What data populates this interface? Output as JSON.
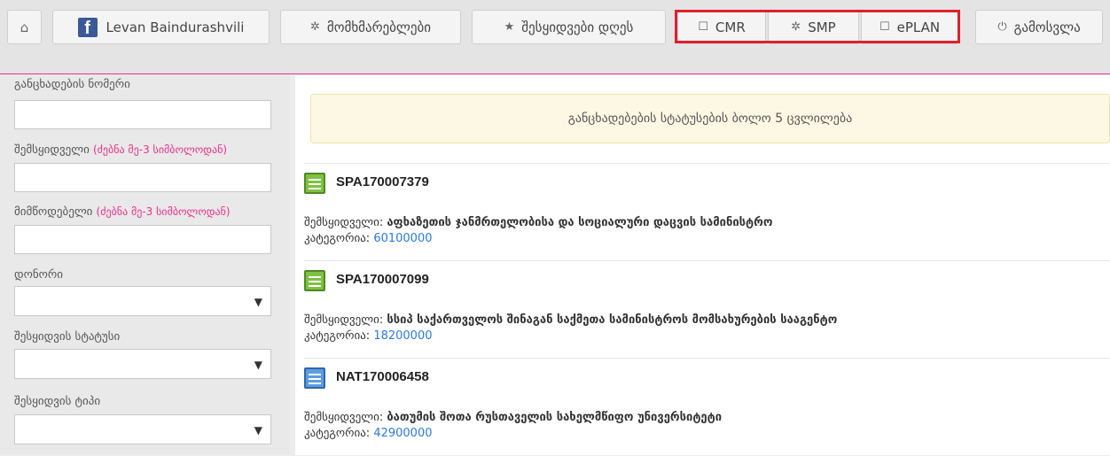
{
  "nav": {
    "home_icon": "home-icon",
    "user_name": "Levan Baindurashvili",
    "users_label": "მომხმარებლები",
    "favorites_label": "შესყიდვები დღეს",
    "cmr_label": "CMR",
    "smp_label": "SMP",
    "eplan_label": "ePLAN",
    "logout_label": "გამოსვლა",
    "highlight_color": "#e0202a"
  },
  "filters": {
    "app_number_label": "განცხადების ნომერი",
    "app_number_value": "",
    "buyer_label": "შემსყიდველი",
    "buyer_hint": "(ძებნა მე-3 სიმბოლოდან)",
    "buyer_value": "",
    "supplier_label": "მიმწოდებელი",
    "supplier_hint": "(ძებნა მე-3 სიმბოლოდან)",
    "supplier_value": "",
    "donor_label": "დონორი",
    "donor_value": "",
    "status_label": "შესყიდვის სტატუსი",
    "status_value": "",
    "type_label": "შესყიდვის ტიპი",
    "type_value": ""
  },
  "main": {
    "banner_text": "განცხადებების სტატუსების ბოლო 5 ცვლილება",
    "items": [
      {
        "code": "SPA170007379",
        "buyer_label": "შემსყიდველი:",
        "buyer": "აფხაზეთის ჯანმრთელობისა და სოციალური დაცვის სამინისტრო",
        "category_label": "კატეგორია:",
        "category": "60100000",
        "icon": "green-document-icon"
      },
      {
        "code": "SPA170007099",
        "buyer_label": "შემსყიდველი:",
        "buyer": "სსიპ საქართველოს შინაგან საქმეთა სამინისტროს მომსახურების სააგენტო",
        "category_label": "კატეგორია:",
        "category": "18200000",
        "icon": "green-document-icon"
      },
      {
        "code": "NAT170006458",
        "buyer_label": "შემსყიდველი:",
        "buyer": "ბათუმის შოთა რუსთაველის სახელმწიფო უნივერსიტეტი",
        "category_label": "კატეგორია:",
        "category": "42900000",
        "icon": "blue-document-icon"
      }
    ]
  }
}
